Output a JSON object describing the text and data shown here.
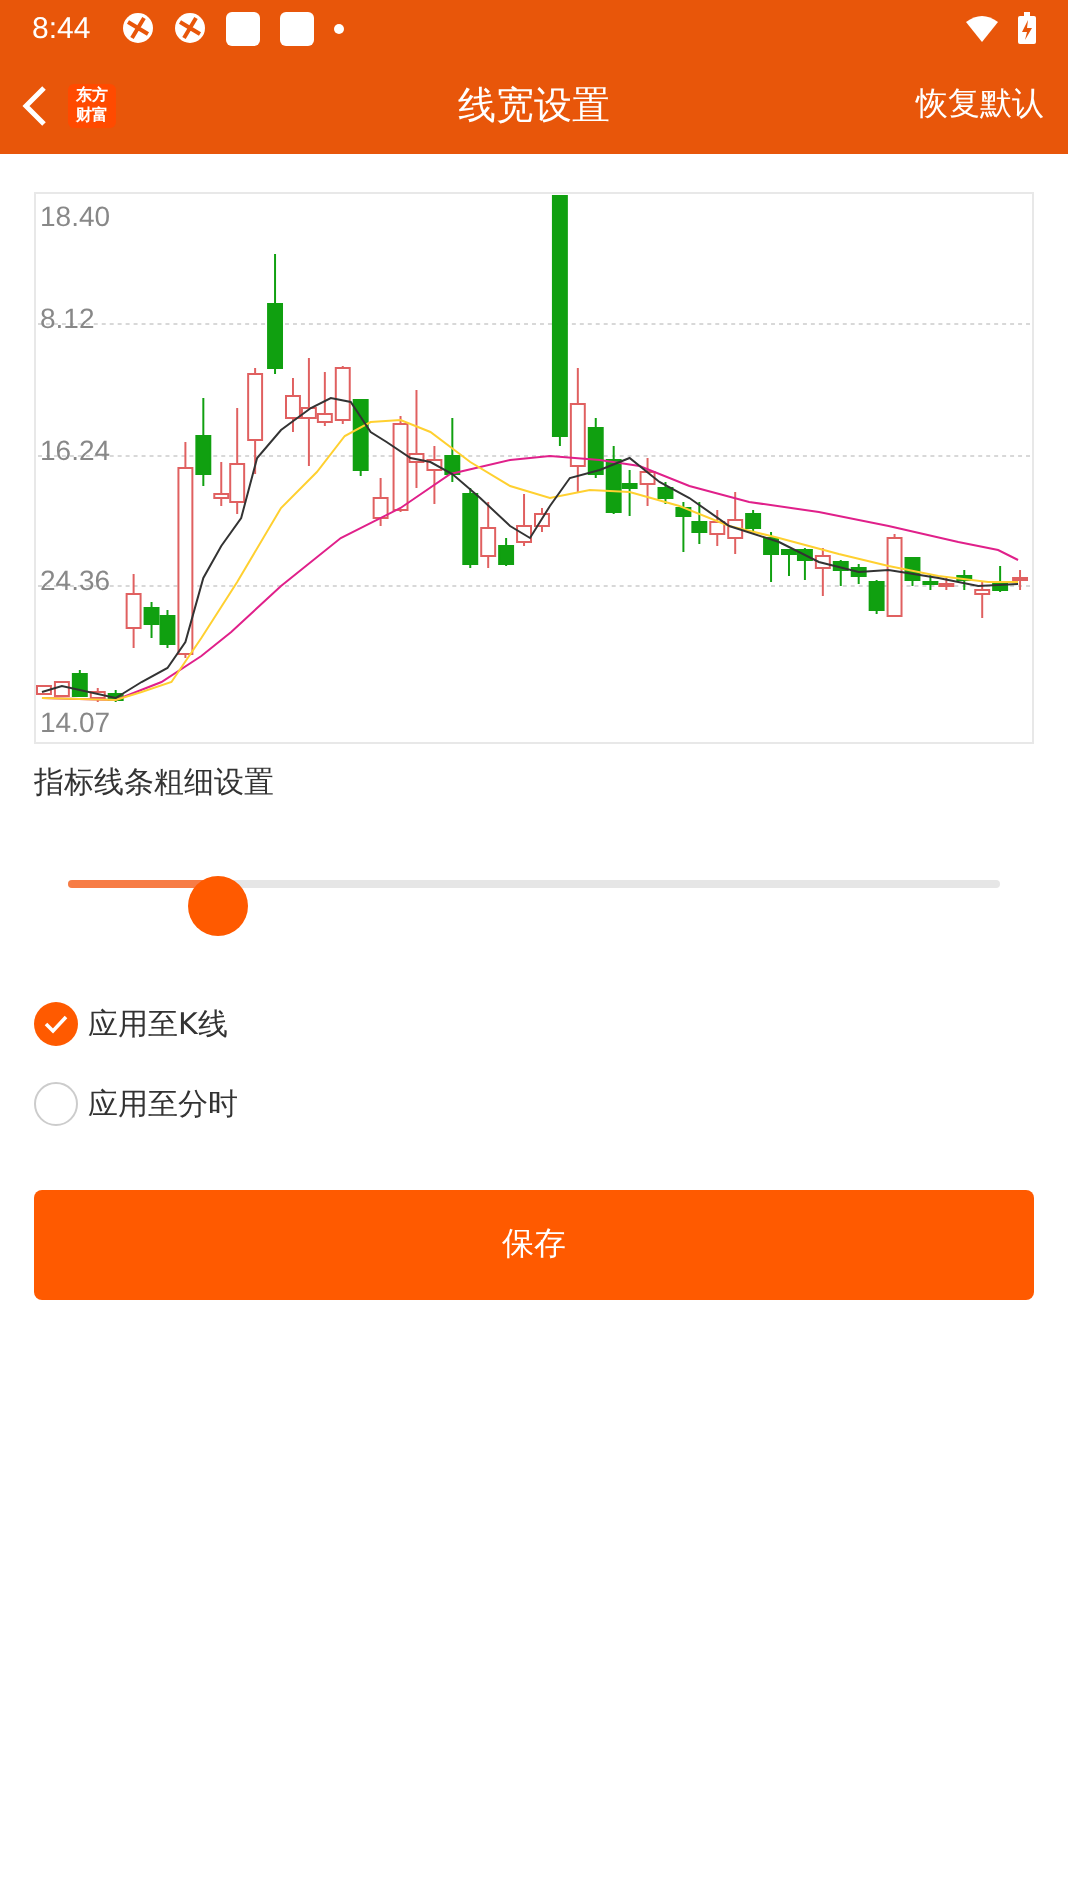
{
  "status_bar": {
    "time": "8:44"
  },
  "header": {
    "logo": [
      "东方",
      "财富"
    ],
    "title": "线宽设置",
    "action": "恢复默认"
  },
  "chart": {
    "kind": "candlestick",
    "y_labels": [
      "18.40",
      "8.12",
      "16.24",
      "24.36",
      "14.07"
    ]
  },
  "line_width": {
    "label": "指标线条粗细设置",
    "level": 0.16
  },
  "options": [
    {
      "label": "应用至K线",
      "selected": true
    },
    {
      "label": "应用至分时",
      "selected": false
    }
  ],
  "save_button": "保存"
}
